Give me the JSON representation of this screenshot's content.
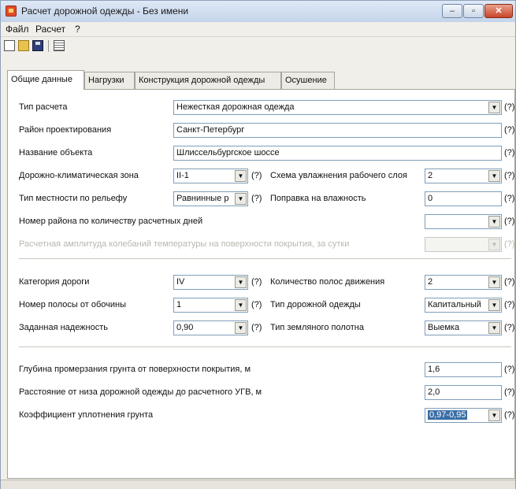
{
  "window": {
    "title": "Расчет дорожной одежды - Без имени"
  },
  "menu": {
    "items": [
      "Файл",
      "Расчет",
      "?"
    ]
  },
  "tabs": [
    "Общие данные",
    "Нагрузки",
    "Конструкция дорожной одежды",
    "Осушение"
  ],
  "help_mark": "(?)",
  "dropdown_glyph": "▼",
  "rows": {
    "calc_type": {
      "label": "Тип расчета",
      "value": "Нежесткая дорожная одежда"
    },
    "region": {
      "label": "Район проектирования",
      "value": "Санкт-Петербург"
    },
    "object_name": {
      "label": "Название объекта",
      "value": "Шлиссельбургское шоссе"
    },
    "climate_zone": {
      "label": "Дорожно-климатическая зона",
      "value": "II-1"
    },
    "moisture_scheme": {
      "label": "Схема увлажнения рабочего слоя",
      "value": "2"
    },
    "terrain": {
      "label": "Тип местности по рельефу",
      "value": "Равнинные р"
    },
    "moisture_corr": {
      "label": "Поправка на влажность",
      "value": "0"
    },
    "region_days": {
      "label": "Номер района по количеству расчетных дней",
      "value": ""
    },
    "temp_amplitude": {
      "label": "Расчетная амплитуда колебаний температуры на поверхности покрытия, за сутки",
      "value": ""
    },
    "road_category": {
      "label": "Категория дороги",
      "value": "IV"
    },
    "lanes": {
      "label": "Количество полос движения",
      "value": "2"
    },
    "lane_number": {
      "label": "Номер полосы от обочины",
      "value": "1"
    },
    "pavement_type": {
      "label": "Тип дорожной одежды",
      "value": "Капитальный"
    },
    "reliability": {
      "label": "Заданная надежность",
      "value": "0,90"
    },
    "subgrade_type": {
      "label": "Тип земляного полотна",
      "value": "Выемка"
    },
    "frost_depth": {
      "label": "Глубина промерзания грунта от поверхности покрытия, м",
      "value": "1,6"
    },
    "gwl_distance": {
      "label": "Расстояние от низа дорожной одежды до расчетного УГВ, м",
      "value": "2,0"
    },
    "compaction": {
      "label": "Коэффициент уплотнения грунта",
      "value": "0,97-0,95"
    }
  }
}
